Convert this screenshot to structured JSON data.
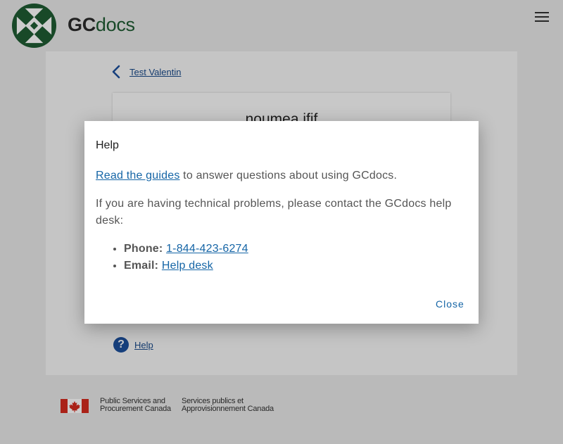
{
  "header": {
    "brand_bold": "GC",
    "brand_rest": "docs",
    "menu_icon": "hamburger-menu-icon"
  },
  "breadcrumb": {
    "back_label": "Test Valentin",
    "back_icon": "chevron-left-icon"
  },
  "panel": {
    "title": "noumea ifif"
  },
  "help_link": {
    "label": "Help",
    "icon": "question-circle-icon"
  },
  "footer": {
    "dept_en_line1": "Public Services and",
    "dept_en_line2": "Procurement Canada",
    "dept_fr_line1": "Services publics et",
    "dept_fr_line2": "Approvisionnement Canada"
  },
  "modal": {
    "title": "Help",
    "guides_link": "Read the guides",
    "guides_text": " to answer questions about using GCdocs.",
    "problems_text": "If you are having technical problems, please contact the GCdocs help desk:",
    "phone_label": "Phone:",
    "phone_value": "1-844-423-6274",
    "email_label": "Email:",
    "email_value": "Help desk",
    "close_label": "Close"
  },
  "colors": {
    "brand_green": "#1f5c33",
    "link_blue": "#1565a6",
    "help_icon_blue": "#1c4f9c",
    "flag_red": "#d52b1e"
  }
}
